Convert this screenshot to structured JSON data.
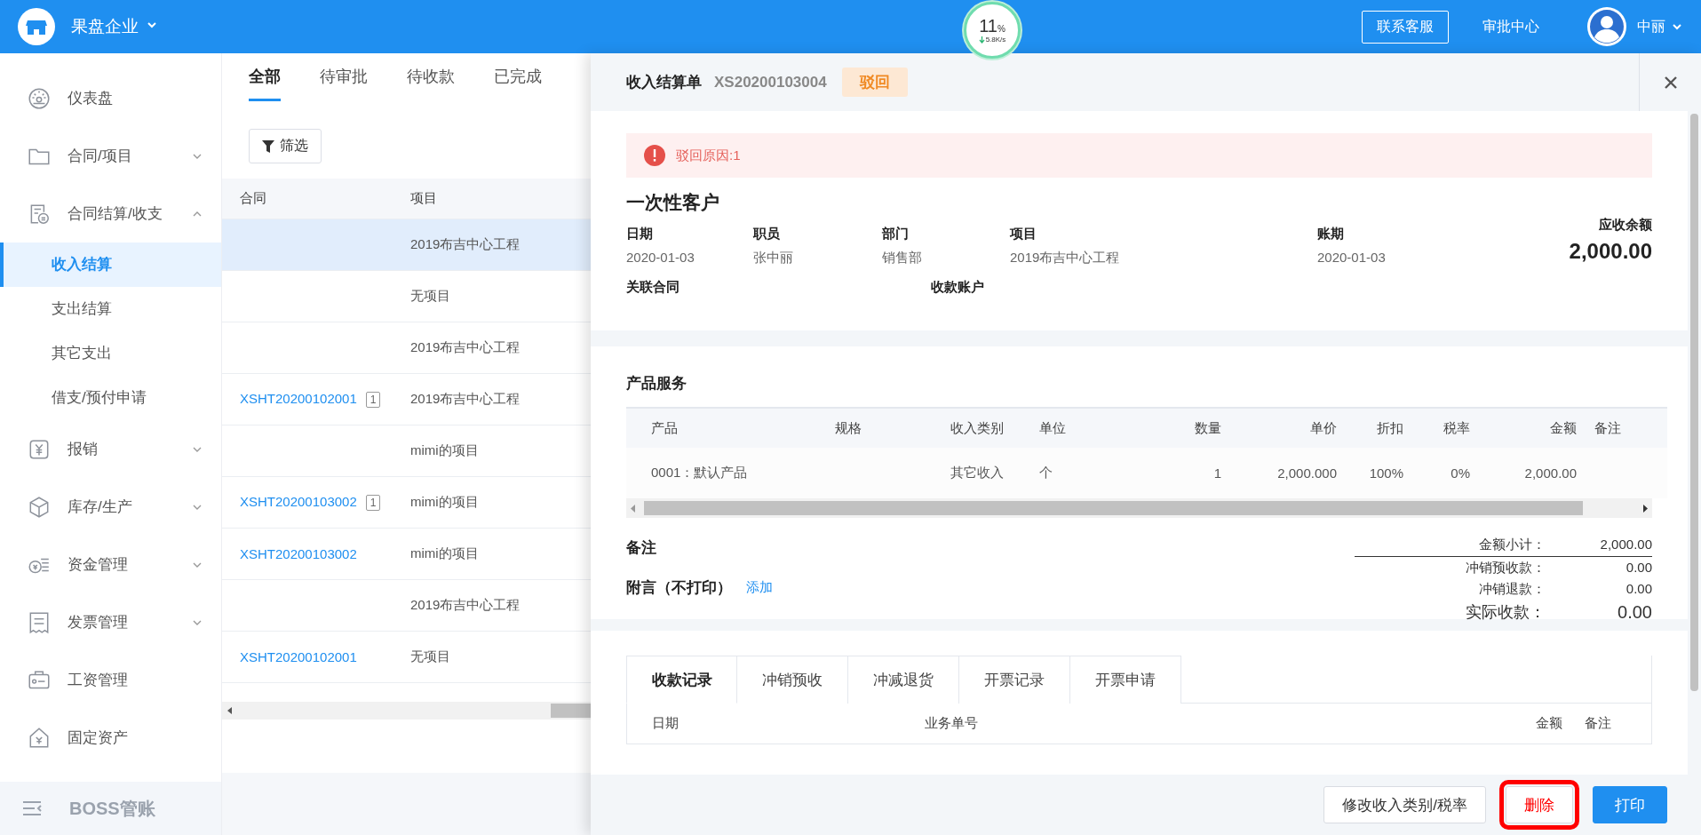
{
  "topbar": {
    "company": "果盘企业",
    "gauge": {
      "percent": "11",
      "unit": "%",
      "speed": "5.8K/s"
    },
    "contact_button": "联系客服",
    "approval_center": "审批中心",
    "user": "中丽"
  },
  "sidebar": {
    "items": [
      {
        "label": "仪表盘",
        "kind": "link"
      },
      {
        "label": "合同/项目",
        "kind": "group",
        "expanded": false
      },
      {
        "label": "合同结算/收支",
        "kind": "group",
        "expanded": true,
        "children": [
          {
            "label": "收入结算",
            "selected": true
          },
          {
            "label": "支出结算",
            "selected": false
          },
          {
            "label": "其它支出",
            "selected": false
          },
          {
            "label": "借支/预付申请",
            "selected": false
          }
        ]
      },
      {
        "label": "报销",
        "kind": "group",
        "expanded": false
      },
      {
        "label": "库存/生产",
        "kind": "group",
        "expanded": false
      },
      {
        "label": "资金管理",
        "kind": "group",
        "expanded": false
      },
      {
        "label": "发票管理",
        "kind": "group",
        "expanded": false
      },
      {
        "label": "工资管理",
        "kind": "link"
      },
      {
        "label": "固定资产",
        "kind": "link"
      }
    ],
    "footer": "BOSS管账"
  },
  "list": {
    "tabs": [
      {
        "label": "全部",
        "selected": true
      },
      {
        "label": "待审批",
        "selected": false
      },
      {
        "label": "待收款",
        "selected": false
      },
      {
        "label": "已完成",
        "selected": false
      }
    ],
    "filter_button": "筛选",
    "columns": [
      "合同",
      "项目"
    ],
    "rows": [
      {
        "project": "2019布吉中心工程",
        "selected": true
      },
      {
        "project": "无项目",
        "selected": false
      },
      {
        "project": "2019布吉中心工程",
        "selected": false
      },
      {
        "contract": "XSHT20200102001",
        "badge": "1",
        "project": "2019布吉中心工程",
        "selected": false
      },
      {
        "project": "mimi的项目",
        "selected": false
      },
      {
        "contract": "XSHT20200103002",
        "badge": "1",
        "project": "mimi的项目",
        "selected": false
      },
      {
        "contract": "XSHT20200103002",
        "project": "mimi的项目",
        "selected": false
      },
      {
        "project": "2019布吉中心工程",
        "selected": false
      },
      {
        "contract": "XSHT20200102001",
        "project": "无项目",
        "selected": false
      }
    ]
  },
  "detail": {
    "title": "收入结算单",
    "number": "XS20200103004",
    "status": "驳回",
    "alert": "驳回原因:1",
    "customer": "一次性客户",
    "fields": [
      {
        "label": "日期",
        "value": "2020-01-03"
      },
      {
        "label": "职员",
        "value": "张中丽"
      },
      {
        "label": "部门",
        "value": "销售部"
      },
      {
        "label": "项目",
        "value": "2019布吉中心工程"
      },
      {
        "label": "账期",
        "value": "2020-01-03"
      }
    ],
    "balance": {
      "label": "应收余额",
      "value": "2,000.00"
    },
    "link_labels": [
      "关联合同",
      "收款账户"
    ],
    "products": {
      "title": "产品服务",
      "columns": [
        "产品",
        "规格",
        "收入类别",
        "单位",
        "数量",
        "单价",
        "折扣",
        "税率",
        "金额",
        "备注"
      ],
      "rows": [
        {
          "product": "0001：默认产品",
          "category": "其它收入",
          "unit": "个",
          "quantity": "1",
          "unit_price": "2,000.000",
          "discount": "100%",
          "tax_rate": "0%",
          "amount": "2,000.00"
        }
      ]
    },
    "remarks_label": "备注",
    "note_label": "附言（不打印）",
    "add_link": "添加",
    "totals": [
      {
        "label": "金额小计：",
        "value": "2,000.00",
        "kind": "subtotal"
      },
      {
        "label": "冲销预收款：",
        "value": "0.00",
        "kind": "line"
      },
      {
        "label": "冲销退款：",
        "value": "0.00",
        "kind": "line"
      },
      {
        "label": "实际收款：",
        "value": "0.00",
        "kind": "total"
      }
    ],
    "records": {
      "tabs": [
        {
          "label": "收款记录",
          "selected": true
        },
        {
          "label": "冲销预收",
          "selected": false
        },
        {
          "label": "冲减退货",
          "selected": false
        },
        {
          "label": "开票记录",
          "selected": false
        },
        {
          "label": "开票申请",
          "selected": false
        }
      ],
      "columns": [
        "日期",
        "业务单号",
        "金额",
        "备注"
      ]
    },
    "buttons": [
      {
        "label": "修改收入类别/税率",
        "kind": "default",
        "highlighted": false
      },
      {
        "label": "删除",
        "kind": "danger",
        "highlighted": true
      },
      {
        "label": "打印",
        "kind": "primary",
        "highlighted": false
      }
    ]
  }
}
